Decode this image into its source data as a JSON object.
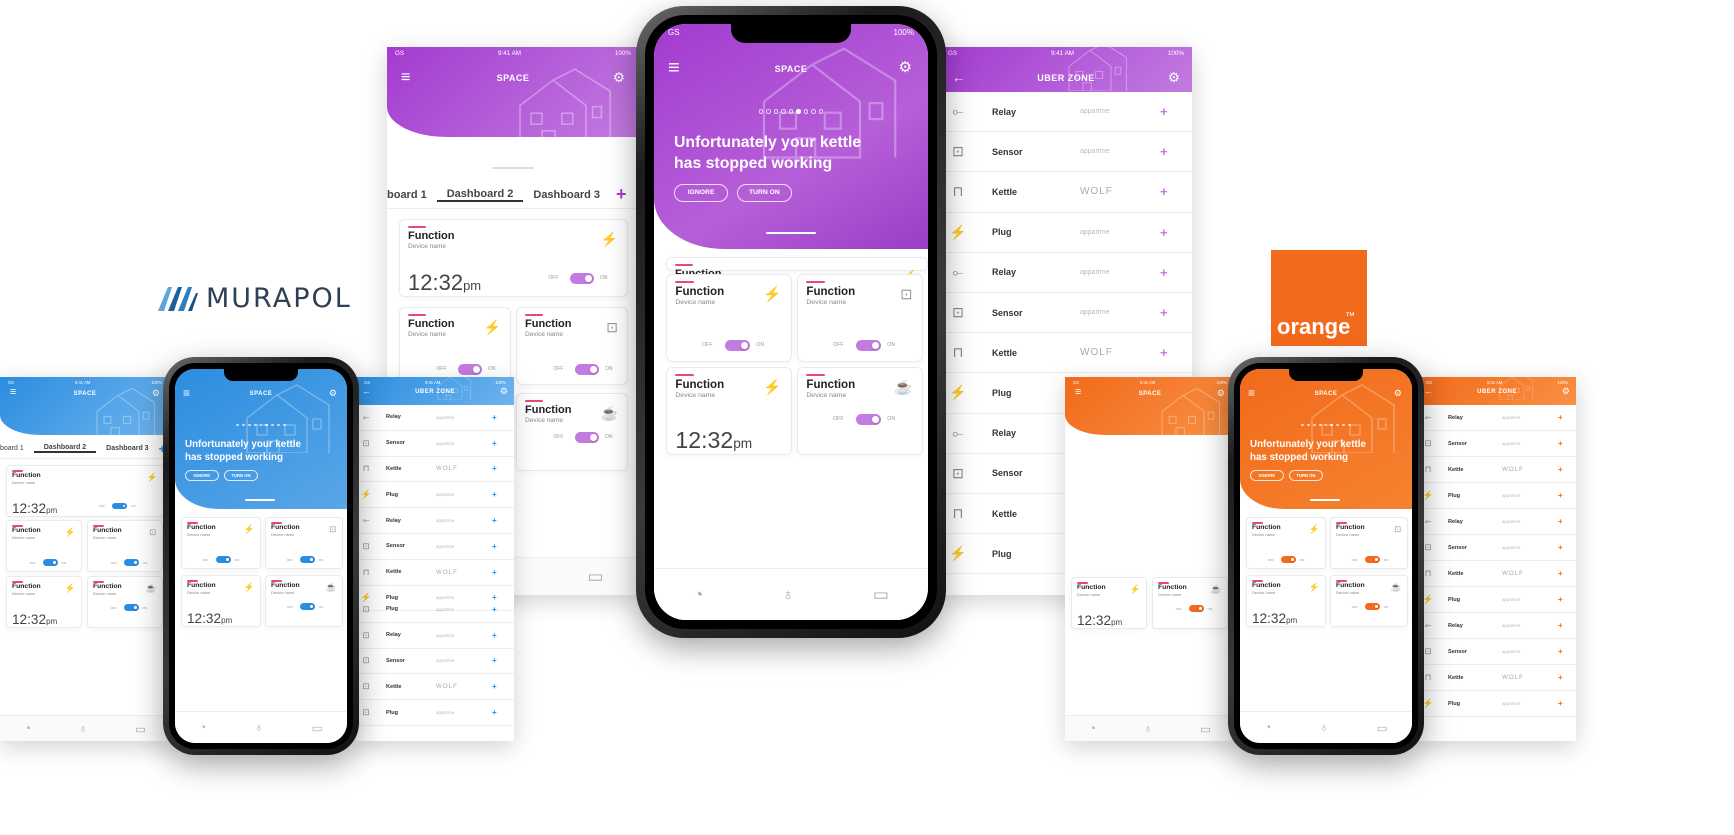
{
  "colors": {
    "purple": "#a33bd0",
    "purple_light": "#c27be0",
    "blue": "#2b8de0",
    "orange": "#f26a1b",
    "red_accent": "#e84a6f"
  },
  "status": {
    "carrier": "GS",
    "time": "9:41 AM",
    "battery": "100%"
  },
  "header": {
    "space_title": "SPACE",
    "uber_title": "UBER ZONE"
  },
  "icons": {
    "menu": "hamburger-icon",
    "settings": "gear-icon",
    "back": "arrow-left-icon",
    "dashboard": "gauge-icon",
    "bulb": "bulb-icon",
    "rooms": "floorplan-icon"
  },
  "tabs": [
    "Dashboard 1",
    "Dashboard 2",
    "Dashboard 3"
  ],
  "tab_partial": "board 1",
  "card": {
    "function": "Function",
    "device": "Device name",
    "time": "12:32",
    "ampm": "pm",
    "off": "OFF",
    "on": "ON"
  },
  "alert": {
    "line1": "Unfortunately your kettle",
    "line2": "has stopped working",
    "ignore": "IGNORE",
    "turn_on": "TURN ON"
  },
  "brands": {
    "murapol": "MURAPOL",
    "orange": "orange",
    "orange_tm": "™"
  },
  "uber_list": [
    {
      "name": "Relay",
      "brand": "appartme",
      "icon": "relay-icon"
    },
    {
      "name": "Sensor",
      "brand": "appartme",
      "icon": "sensor-icon"
    },
    {
      "name": "Kettle",
      "brand": "WOLF",
      "icon": "kettle-icon"
    },
    {
      "name": "Plug",
      "brand": "appartme",
      "icon": "plug-icon"
    },
    {
      "name": "Relay",
      "brand": "appartme",
      "icon": "relay-icon"
    },
    {
      "name": "Sensor",
      "brand": "appartme",
      "icon": "sensor-icon"
    },
    {
      "name": "Kettle",
      "brand": "WOLF",
      "icon": "kettle-icon"
    },
    {
      "name": "Plug",
      "brand": "appartme",
      "icon": "plug-icon"
    },
    {
      "name": "Relay",
      "brand": "appartme",
      "icon": "relay-icon"
    },
    {
      "name": "Sensor",
      "brand": "appartme",
      "icon": "sensor-icon"
    },
    {
      "name": "Kettle",
      "brand": "WOLF",
      "icon": "kettle-icon"
    },
    {
      "name": "Plug",
      "brand": "appartme",
      "icon": "plug-icon"
    }
  ],
  "left_list": [
    {
      "name": "Plug",
      "brand": "appartme"
    },
    {
      "name": "Relay",
      "brand": "appartme"
    },
    {
      "name": "Sensor",
      "brand": "appartme"
    },
    {
      "name": "Kettle",
      "brand": "WOLF"
    },
    {
      "name": "Plug",
      "brand": "appartme"
    }
  ]
}
